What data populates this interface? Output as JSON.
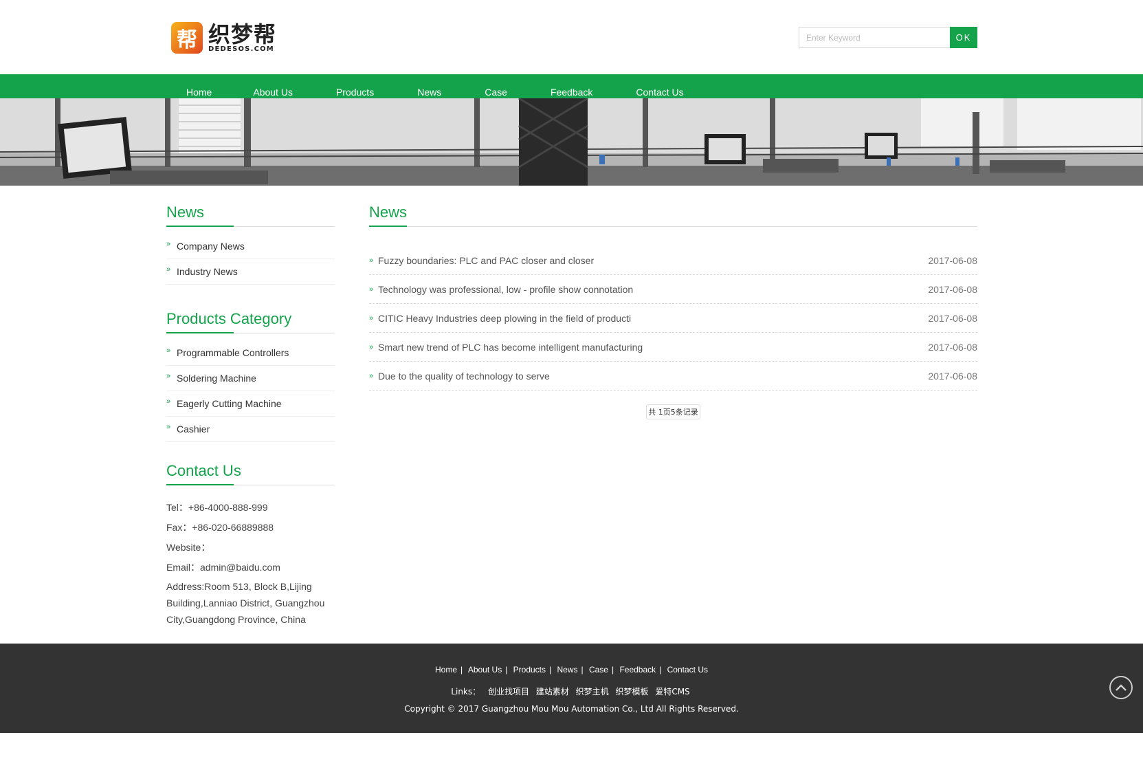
{
  "logo": {
    "mark": "帮",
    "cn_text": "织梦帮",
    "en_text": "DEDESOS.COM"
  },
  "search": {
    "placeholder": "Enter Keyword",
    "button_label": "OK"
  },
  "nav": {
    "items": [
      "Home",
      "About Us",
      "Products",
      "News",
      "Case",
      "Feedback",
      "Contact Us"
    ]
  },
  "sidebar": {
    "news": {
      "title": "News",
      "items": [
        "Company News",
        "Industry News"
      ]
    },
    "products": {
      "title": "Products Category",
      "items": [
        "Programmable Controllers",
        "Soldering Machine",
        "Eagerly Cutting Machine",
        "Cashier"
      ]
    },
    "contact": {
      "title": "Contact Us",
      "tel": "Tel：+86-4000-888-999",
      "fax": "Fax：+86-020-66889888",
      "website": "Website：",
      "email": "Email：admin@baidu.com",
      "address": "Address:Room 513, Block B,Lijing Building,Lanniao District, Guangzhou City,Guangdong Province, China"
    }
  },
  "main": {
    "title": "News",
    "articles": [
      {
        "title": "Fuzzy boundaries: PLC and PAC closer and closer",
        "date": "2017-06-08"
      },
      {
        "title": "Technology was professional, low - profile show connotation",
        "date": "2017-06-08"
      },
      {
        "title": "CITIC Heavy Industries deep plowing in the field of producti",
        "date": "2017-06-08"
      },
      {
        "title": "Smart new trend of PLC has become intelligent manufacturing",
        "date": "2017-06-08"
      },
      {
        "title": "Due to the quality of technology to serve",
        "date": "2017-06-08"
      }
    ],
    "pager": "共 1页5条记录"
  },
  "footer": {
    "nav": [
      "Home",
      "About Us",
      "Products",
      "News",
      "Case",
      "Feedback",
      "Contact Us"
    ],
    "links_label": "Links：",
    "links": [
      "创业找项目",
      "建站素材",
      "织梦主机",
      "织梦模板",
      "爱特CMS"
    ],
    "copyright": "Copyright © 2017 Guangzhou Mou Mou Automation Co., Ltd All Rights Reserved."
  },
  "colors": {
    "brand_green": "#14a34a",
    "footer_bg": "#333333"
  },
  "icons": {
    "back_to_top": "chevron-up-circle-icon",
    "list_bullet": "double-chevron-right-icon"
  }
}
